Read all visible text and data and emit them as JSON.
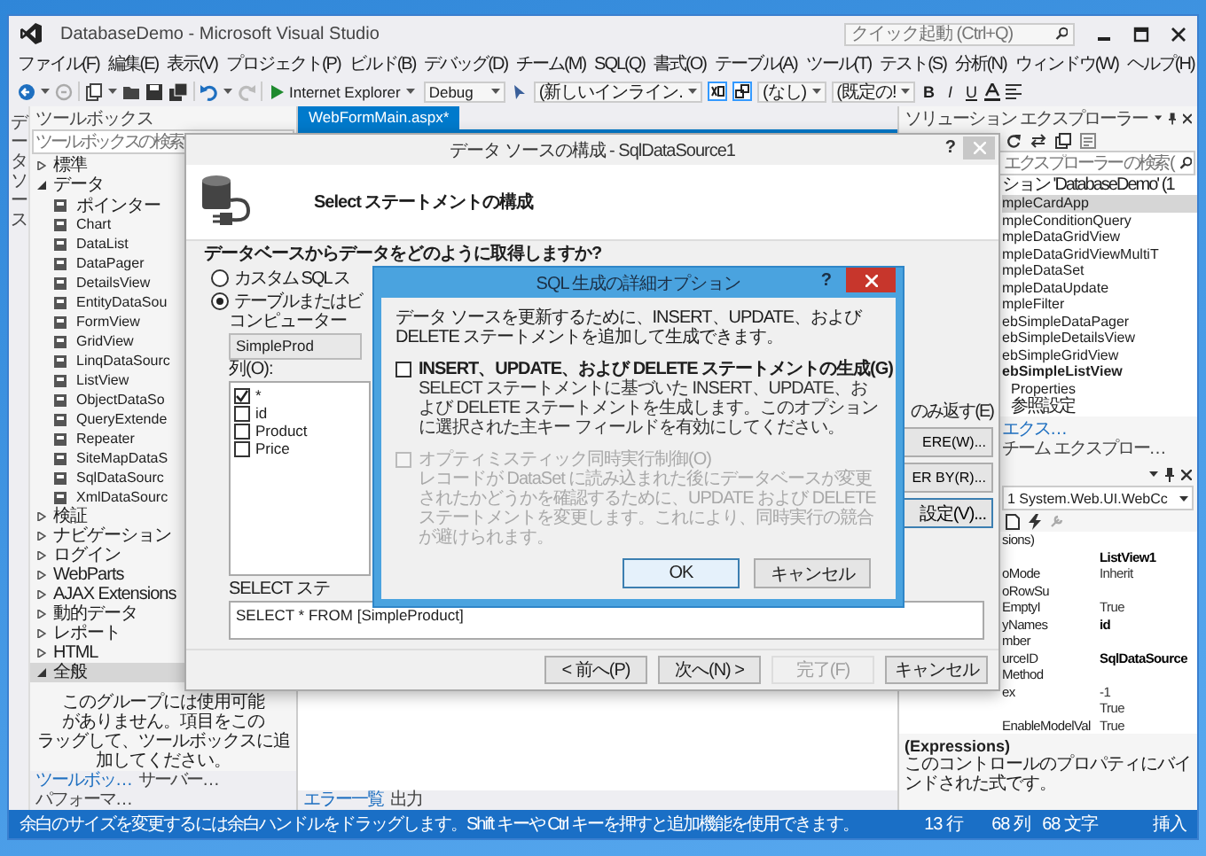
{
  "window": {
    "title": "DatabaseDemo - Microsoft Visual Studio",
    "quick_launch": {
      "placeholder": "クイック起動 (Ctrl+Q)"
    }
  },
  "menu": [
    "ファイル(F)",
    "編集(E)",
    "表示(V)",
    "プロジェクト(P)",
    "ビルド(B)",
    "デバッグ(D)",
    "チーム(M)",
    "SQL(Q)",
    "書式(O)",
    "テーブル(A)",
    "ツール(T)",
    "テスト(S)",
    "分析(N)",
    "ウィンドウ(W)",
    "ヘルプ(H)"
  ],
  "toolbar": {
    "run_target": "Internet Explorer",
    "configuration": "Debug",
    "block_format": "(新しいインライン.",
    "target_rule": "(なし)",
    "font_name": "(既定の!",
    "format_buttons": [
      "B",
      "I",
      "U"
    ]
  },
  "side_strip": {
    "label": "データソース"
  },
  "toolbox": {
    "title": "ツールボックス",
    "search": {
      "placeholder": "ツールボックスの検索"
    },
    "groups": [
      {
        "label": "標準",
        "expanded": false,
        "selected": false
      },
      {
        "label": "データ",
        "expanded": true,
        "selected": false,
        "children": [
          {
            "label": "ポインター"
          },
          {
            "label": "Chart"
          },
          {
            "label": "DataList"
          },
          {
            "label": "DataPager"
          },
          {
            "label": "DetailsView"
          },
          {
            "label": "EntityDataSou"
          },
          {
            "label": "FormView"
          },
          {
            "label": "GridView"
          },
          {
            "label": "LinqDataSourc"
          },
          {
            "label": "ListView"
          },
          {
            "label": "ObjectDataSo"
          },
          {
            "label": "QueryExtende"
          },
          {
            "label": "Repeater"
          },
          {
            "label": "SiteMapDataS"
          },
          {
            "label": "SqlDataSourc"
          },
          {
            "label": "XmlDataSourc"
          }
        ]
      },
      {
        "label": "検証",
        "expanded": false,
        "selected": false
      },
      {
        "label": "ナビゲーション",
        "expanded": false,
        "selected": false
      },
      {
        "label": "ログイン",
        "expanded": false,
        "selected": false
      },
      {
        "label": "WebParts",
        "expanded": false,
        "selected": false
      },
      {
        "label": "AJAX Extensions",
        "expanded": false,
        "selected": false
      },
      {
        "label": "動的データ",
        "expanded": false,
        "selected": false
      },
      {
        "label": "レポート",
        "expanded": false,
        "selected": false
      },
      {
        "label": "HTML",
        "expanded": false,
        "selected": false
      },
      {
        "label": "全般",
        "expanded": true,
        "selected": true
      }
    ],
    "message": [
      "このグループには使用可能",
      "がありません。項目をこの",
      "ラッグして、ツールボックスに追加してください。"
    ],
    "tabs": [
      {
        "label": "ツールボッ…",
        "selected": true
      },
      {
        "label": "サーバー…",
        "selected": false
      },
      {
        "label": "パフォーマ…",
        "selected": false
      }
    ]
  },
  "document": {
    "tabs": [
      {
        "label": "WebFormMain.aspx*",
        "selected": true
      }
    ],
    "bottom_tabs": [
      {
        "label": "エラー一覧",
        "selected": true
      },
      {
        "label": "出力",
        "selected": false
      }
    ]
  },
  "solution_explorer": {
    "title": "ソリューション エクスプローラー",
    "search": {
      "placeholder": "エクスプローラー の検索 ("
    },
    "items": [
      {
        "label": "ション 'DatabaseDemo' (1",
        "selected": false,
        "startup": false
      },
      {
        "label": "mpleCardApp",
        "selected": true,
        "startup": false
      },
      {
        "label": "mpleConditionQuery",
        "selected": false,
        "startup": false
      },
      {
        "label": "mpleDataGridView",
        "selected": false,
        "startup": false
      },
      {
        "label": "mpleDataGridViewMultiT",
        "selected": false,
        "startup": false
      },
      {
        "label": "mpleDataSet",
        "selected": false,
        "startup": false
      },
      {
        "label": "mpleDataUpdate",
        "selected": false,
        "startup": false
      },
      {
        "label": "mpleFilter",
        "selected": false,
        "startup": false
      },
      {
        "label": "ebSimpleDataPager",
        "selected": false,
        "startup": false
      },
      {
        "label": "ebSimpleDetailsView",
        "selected": false,
        "startup": false
      },
      {
        "label": "ebSimpleGridView",
        "selected": false,
        "startup": false
      },
      {
        "label": "ebSimpleListView",
        "selected": false,
        "startup": true,
        "children": [
          {
            "label": "Properties",
            "selected": false,
            "startup": false
          },
          {
            "label": "参照設定",
            "selected": false,
            "startup": false
          }
        ]
      }
    ],
    "tabs": [
      {
        "label": "エクス…",
        "selected": true
      },
      {
        "label": "チーム エクスプロー…",
        "selected": false
      }
    ]
  },
  "properties": {
    "object": "1 System.Web.UI.WebCc",
    "rows": [
      {
        "name": "sions)"
      },
      {
        "value": "ListView1",
        "modified": true
      },
      {
        "name": "oMode",
        "value": "Inherit",
        "modified": false
      },
      {
        "name": "oRowSu"
      },
      {
        "name": "EmptyI",
        "value": "True",
        "modified": false
      },
      {
        "name": "yNames",
        "value": "id",
        "modified": true
      },
      {
        "name": "mber"
      },
      {
        "name": "urceID",
        "value": "SqlDataSource",
        "modified": true
      },
      {
        "name": "Method"
      },
      {
        "name": "ex",
        "value": "-1",
        "modified": false
      },
      {
        "value": "True",
        "modified": false
      },
      {
        "name": "EnableModelVal",
        "value": "True",
        "modified": false
      }
    ],
    "description": {
      "title": "(Expressions)",
      "text": "このコントロールのプロパティにバインドされた式です。"
    }
  },
  "data_source_dialog": {
    "title": "データ ソースの構成 - SqlDataSource1",
    "help": "?",
    "heading": "Select ステートメントの構成",
    "question": "データベースからデータをどのように取得しますか?",
    "options": [
      {
        "label": "カスタム SQL ス",
        "selected": false
      },
      {
        "label": "テーブルまたはビ",
        "selected": true
      }
    ],
    "table_label": "コンピューター",
    "table": "SimpleProd",
    "columns_label": "列(O):",
    "columns": [
      {
        "label": "*",
        "checked": true
      },
      {
        "label": "id",
        "checked": false
      },
      {
        "label": "Product",
        "checked": false
      },
      {
        "label": "Price",
        "checked": false
      }
    ],
    "distinct_label": "のみ返す(E)",
    "side_buttons": [
      "ERE(W)...",
      "ER BY(R)...",
      "設定(V)..."
    ],
    "sql_label": "SELECT ステ",
    "sql": "SELECT * FROM [SimpleProduct]",
    "buttons": [
      {
        "label": "< 前へ(P)",
        "disabled": false
      },
      {
        "label": "次へ(N) >",
        "disabled": false
      },
      {
        "label": "完了(F)",
        "disabled": true
      },
      {
        "label": "キャンセル",
        "disabled": false
      }
    ]
  },
  "advanced_dialog": {
    "title": "SQL 生成の詳細オプション",
    "help": "?",
    "intro": "データ ソースを更新するために、INSERT、UPDATE、および DELETE ステートメントを追加して生成できます。",
    "options": [
      {
        "label": "INSERT、UPDATE、および DELETE ステートメントの生成(G)",
        "description": "SELECT ステートメントに基づいた INSERT、UPDATE、および DELETE ステートメントを生成します。このオプションに選択された主キー フィールドを有効にしてください。",
        "checked": false,
        "disabled": false
      },
      {
        "label": "オプティミスティック同時実行制御(O)",
        "description": "レコードが DataSet に読み込まれた後にデータベースが変更されたかどうかを確認するために、UPDATE および DELETE ステートメントを変更します。これにより、同時実行の競合が避けられます。",
        "checked": false,
        "disabled": true
      }
    ],
    "buttons": [
      {
        "label": "OK",
        "default": true
      },
      {
        "label": "キャンセル",
        "default": false
      }
    ]
  },
  "status_bar": {
    "message": "余白のサイズを変更するには余白ハンドルをドラッグします。Shift キーや Ctrl キーを押すと追加機能を使用できます。",
    "line": "13 行",
    "column": "68 列",
    "chars": "68 文字",
    "mode": "挿入"
  }
}
